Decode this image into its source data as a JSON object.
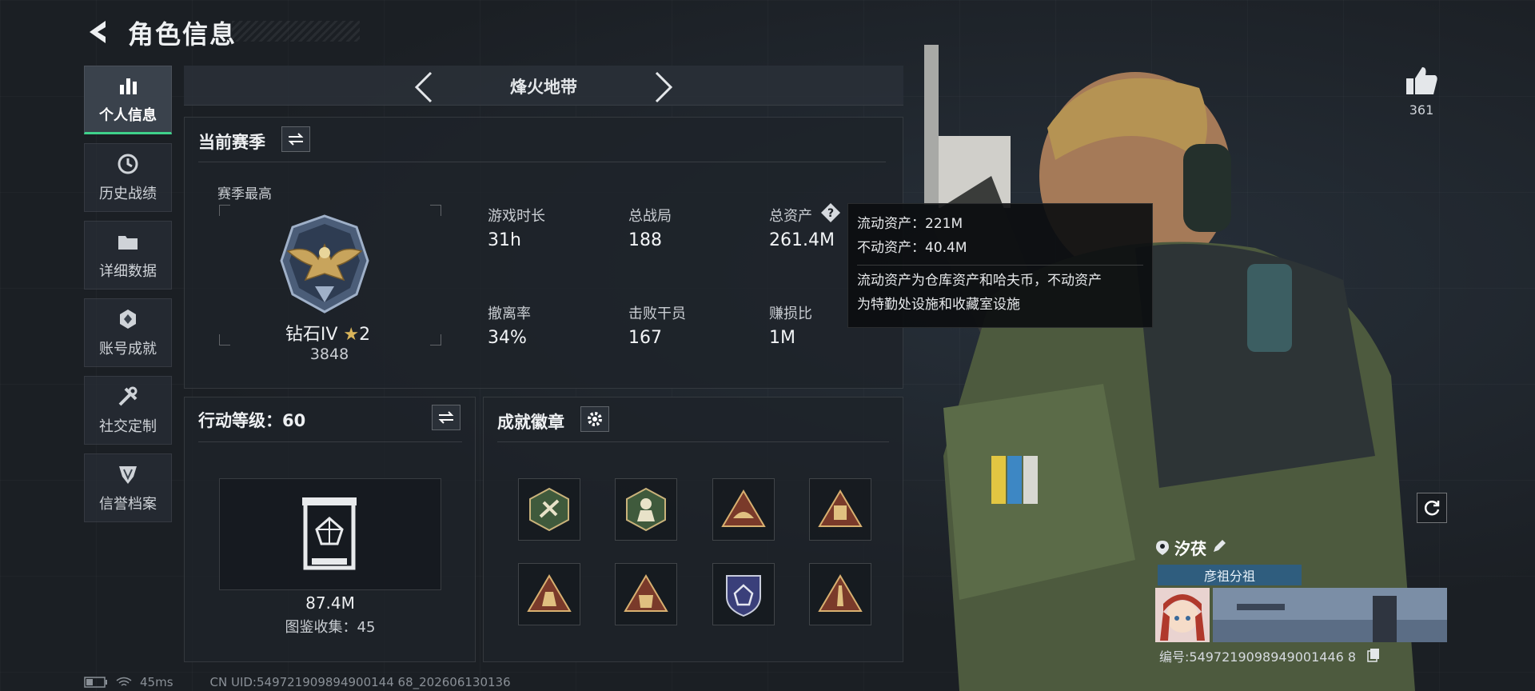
{
  "header": {
    "title": "角色信息"
  },
  "sidebar": {
    "items": [
      {
        "label": "个人信息",
        "active": true,
        "icon": "bar-chart-icon"
      },
      {
        "label": "历史战绩",
        "active": false,
        "icon": "clock-icon"
      },
      {
        "label": "详细数据",
        "active": false,
        "icon": "folder-icon"
      },
      {
        "label": "账号成就",
        "active": false,
        "icon": "medal-icon"
      },
      {
        "label": "社交定制",
        "active": false,
        "icon": "wrench-icon"
      },
      {
        "label": "信誉档案",
        "active": false,
        "icon": "shield-icon"
      }
    ]
  },
  "map": {
    "name": "烽火地带"
  },
  "season": {
    "title": "当前赛季",
    "best_label": "赛季最高",
    "rank": "钻石IV",
    "stars": "2",
    "score": "3848",
    "stats": [
      {
        "label": "游戏时长",
        "value": "31h"
      },
      {
        "label": "总战局",
        "value": "188"
      },
      {
        "label": "总资产",
        "value": "261.4M"
      },
      {
        "label": "撤离率",
        "value": "34%"
      },
      {
        "label": "击败干员",
        "value": "167"
      },
      {
        "label": "赚损比",
        "value": "1M"
      }
    ]
  },
  "tooltip": {
    "liquid": "流动资产：221M",
    "fixed": "不动资产：40.4M",
    "desc_1": "流动资产为仓库资产和哈夫币，不动资产",
    "desc_2": "为特勤处设施和收藏室设施"
  },
  "level": {
    "title": "行动等级：60",
    "value": "87.4M",
    "collection": "图鉴收集：45"
  },
  "badges": {
    "title": "成就徽章",
    "items": [
      "badge-hex-green-1",
      "badge-hex-green-2",
      "badge-triangle-1",
      "badge-triangle-2",
      "badge-triangle-3",
      "badge-triangle-56",
      "badge-shield-blue",
      "badge-triangle-4"
    ]
  },
  "character": {
    "likes": "361",
    "player_name": "汐茯",
    "squad": "彦祖分祖",
    "player_id": "编号:5497219098949001446 8"
  },
  "status": {
    "ping": "45ms",
    "uid": "CN UID:549721909894900144 68_202606130136"
  },
  "colors": {
    "accent": "#3fd28b",
    "squad": "#2f5d7e",
    "bg": "#1b1f24"
  }
}
